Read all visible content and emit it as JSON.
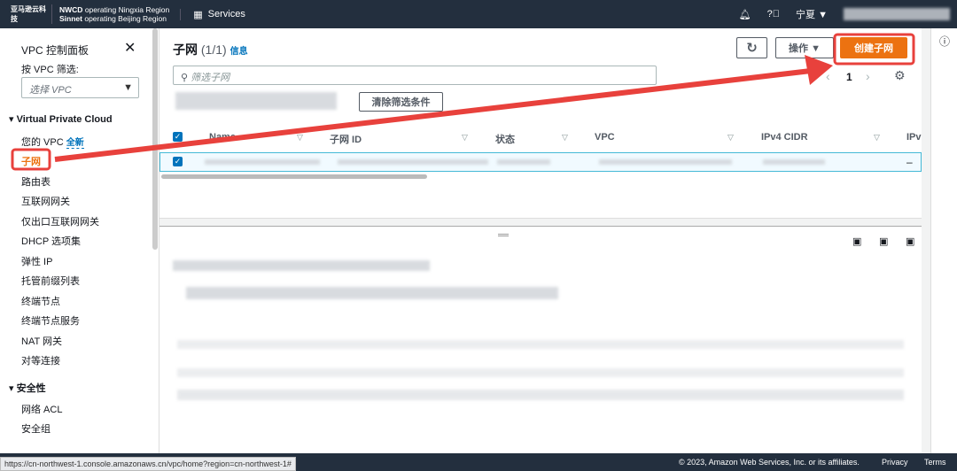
{
  "header": {
    "logo": "亚马逊云科技",
    "region_line1_bold": "NWCD",
    "region_line1": " operating Ningxia Region",
    "region_line2_bold": "Sinnet",
    "region_line2": " operating Beijing Region",
    "services": "Services",
    "region_select": "宁夏 ▼"
  },
  "sidebar": {
    "title": "VPC 控制面板",
    "filter_label": "按 VPC 筛选:",
    "filter_placeholder": "选择 VPC",
    "section1": "Virtual Private Cloud",
    "items": [
      "您的 VPC",
      "子网",
      "路由表",
      "互联网网关",
      "仅出口互联网网关",
      "DHCP 选项集",
      "弹性 IP",
      "托管前缀列表",
      "终端节点",
      "终端节点服务",
      "NAT 网关",
      "对等连接"
    ],
    "new_badge": "全新",
    "section2": "安全性",
    "items2": [
      "网络 ACL",
      "安全组"
    ]
  },
  "main": {
    "title": "子网",
    "count": "(1/1)",
    "info": "信息",
    "actions": "操作 ▼",
    "create": "创建子网",
    "search_placeholder": "筛选子网",
    "clear_filters": "清除筛选条件",
    "page": "1",
    "columns": [
      "Name",
      "子网 ID",
      "状态",
      "VPC",
      "IPv4 CIDR",
      "IPv"
    ],
    "row_dash": "–"
  },
  "footer": {
    "copyright": "© 2023, Amazon Web Services, Inc. or its affiliates.",
    "privacy": "Privacy",
    "terms": "Terms",
    "status_url": "https://cn-northwest-1.console.amazonaws.cn/vpc/home?region=cn-northwest-1#"
  },
  "colors": {
    "header": "#232f3e",
    "primary": "#ec7211",
    "annotation": "#e8413c",
    "link": "#0073bb"
  }
}
